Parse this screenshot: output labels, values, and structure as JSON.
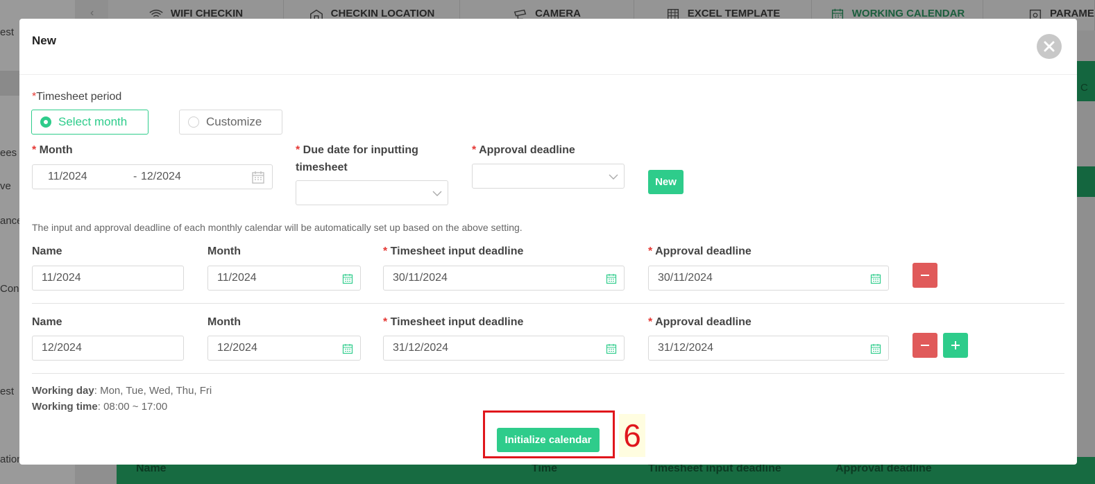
{
  "background": {
    "sidebar_fragments": [
      "est",
      "ees",
      "ve",
      "ance",
      "Con",
      "est",
      "ation"
    ],
    "tabs": [
      {
        "label": "WIFI CHECKIN",
        "icon": "wifi-icon"
      },
      {
        "label": "CHECKIN LOCATION",
        "icon": "location-icon"
      },
      {
        "label": "CAMERA",
        "icon": "camera-icon"
      },
      {
        "label": "EXCEL TEMPLATE",
        "icon": "grid-icon"
      },
      {
        "label": "WORKING CALENDAR",
        "icon": "calendar-icon"
      },
      {
        "label": "PARAME",
        "icon": "settings-icon"
      }
    ],
    "right_fragment": "C",
    "table_headers": [
      "Name",
      "Time",
      "Timesheet input deadline",
      "Approval deadline"
    ]
  },
  "modal": {
    "title": "New",
    "timesheet_period": {
      "label": "Timesheet period",
      "options": [
        {
          "label": "Select month",
          "checked": true
        },
        {
          "label": "Customize",
          "checked": false
        }
      ]
    },
    "month_label": "Month",
    "month_range": {
      "start": "11/2024",
      "separator": "-",
      "end": "12/2024"
    },
    "due_date_label": "Due date for inputting timesheet",
    "approval_deadline_label": "Approval deadline",
    "new_button": "New",
    "note": "The input and approval deadline of each monthly calendar will be automatically set up based on the above setting.",
    "row_labels": {
      "name": "Name",
      "month": "Month",
      "input_deadline": "Timesheet input deadline",
      "approval_deadline": "Approval deadline"
    },
    "rows": [
      {
        "name": "11/2024",
        "month": "11/2024",
        "input_deadline": "30/11/2024",
        "approval_deadline": "30/11/2024"
      },
      {
        "name": "12/2024",
        "month": "12/2024",
        "input_deadline": "31/12/2024",
        "approval_deadline": "31/12/2024"
      }
    ],
    "working_day_label": "Working day",
    "working_day_value": ": Mon, Tue, Wed, Thu, Fri",
    "working_time_label": "Working time",
    "working_time_value": ": 08:00 ~ 17:00",
    "initialize_button": "Initialize calendar",
    "annotation_number": "6"
  },
  "colors": {
    "accent_green": "#2ecc8b",
    "danger_red": "#e05a5a",
    "annotation_red": "#e0161c"
  }
}
